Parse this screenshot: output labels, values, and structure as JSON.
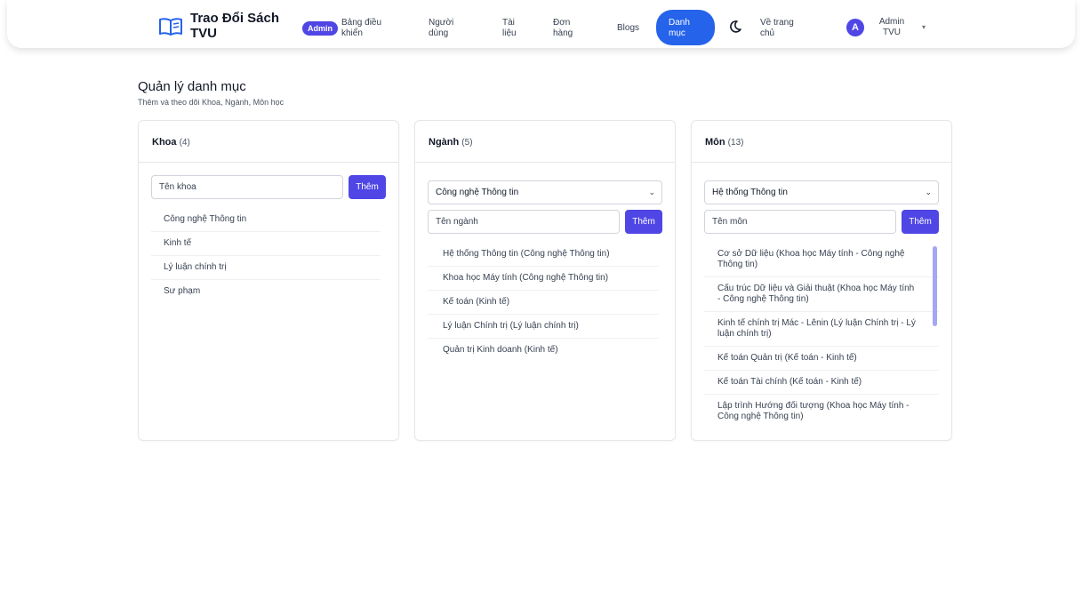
{
  "header": {
    "brand": "Trao Đổi Sách TVU",
    "admin_badge": "Admin",
    "nav": [
      {
        "label": "Bảng điều khiển"
      },
      {
        "label": "Người dùng"
      },
      {
        "label": "Tài liệu"
      },
      {
        "label": "Đơn hàng"
      },
      {
        "label": "Blogs"
      },
      {
        "label": "Danh mục",
        "active": true
      },
      {
        "label": "Về trang chủ"
      }
    ],
    "user_initial": "A",
    "user_name": "Admin TVU",
    "accent": "#4f46e5",
    "active_color": "#2563eb"
  },
  "page": {
    "title": "Quản lý danh mục",
    "subtitle": "Thêm và theo dõi Khoa, Ngành, Môn học"
  },
  "khoa": {
    "title": "Khoa",
    "count": "(4)",
    "input_placeholder": "Tên khoa",
    "add_label": "Thêm",
    "items": [
      "Công nghệ Thông tin",
      "Kinh tế",
      "Lý luận chính trị",
      "Sư phạm"
    ]
  },
  "nganh": {
    "title": "Ngành",
    "count": "(5)",
    "select_value": "Công nghệ Thông tin",
    "input_placeholder": "Tên ngành",
    "add_label": "Thêm",
    "items": [
      "Hệ thống Thông tin (Công nghệ Thông tin)",
      "Khoa học Máy tính (Công nghệ Thông tin)",
      "Kế toán (Kinh tế)",
      "Lý luận Chính trị (Lý luận chính trị)",
      "Quản trị Kinh doanh (Kinh tế)"
    ]
  },
  "mon": {
    "title": "Môn",
    "count": "(13)",
    "select_value": "Hệ thống Thông tin",
    "input_placeholder": "Tên môn",
    "add_label": "Thêm",
    "items": [
      "Cơ sở Dữ liệu (Khoa học Máy tính - Công nghệ Thông tin)",
      "Cấu trúc Dữ liệu và Giải thuật (Khoa học Máy tính - Công nghệ Thông tin)",
      "Kinh tế chính trị Mác - Lênin (Lý luận Chính trị - Lý luận chính trị)",
      "Kế toán Quản trị (Kế toán - Kinh tế)",
      "Kế toán Tài chính (Kế toán - Kinh tế)",
      "Lập trình Hướng đối tượng (Khoa học Máy tính - Công nghệ Thông tin)"
    ]
  }
}
